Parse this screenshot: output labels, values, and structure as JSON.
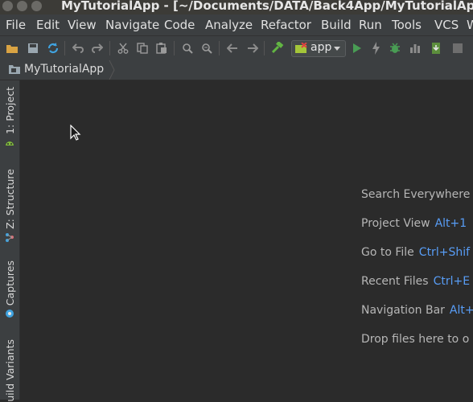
{
  "window": {
    "title": "MyTutorialApp - [~/Documents/DATA/Back4App/MyTutorialApp] - "
  },
  "menu": [
    {
      "label": "File"
    },
    {
      "label": "Edit"
    },
    {
      "label": "View"
    },
    {
      "label": "Navigate"
    },
    {
      "label": "Code"
    },
    {
      "label": "Analyze"
    },
    {
      "label": "Refactor"
    },
    {
      "label": "Build"
    },
    {
      "label": "Run"
    },
    {
      "label": "Tools"
    },
    {
      "label": "VCS"
    },
    {
      "label": "W"
    }
  ],
  "toolbar": {
    "run_config": "app",
    "icons": [
      "open-folder",
      "save-all",
      "sync",
      "undo",
      "redo",
      "cut",
      "copy",
      "paste",
      "find",
      "replace",
      "back",
      "forward",
      "make-project",
      "run",
      "apply-changes",
      "debug",
      "profile",
      "stop",
      "sdk-manager"
    ]
  },
  "breadcrumb": {
    "project": "MyTutorialApp"
  },
  "side_tabs": [
    {
      "label": "1: Project"
    },
    {
      "label": "Z: Structure"
    },
    {
      "label": "Captures"
    },
    {
      "label": "uild Variants"
    }
  ],
  "hints": [
    {
      "label": "Search Everywhere",
      "shortcut": ""
    },
    {
      "label": "Project View",
      "shortcut": "Alt+1"
    },
    {
      "label": "Go to File",
      "shortcut": "Ctrl+Shif"
    },
    {
      "label": "Recent Files",
      "shortcut": "Ctrl+E"
    },
    {
      "label": "Navigation Bar",
      "shortcut": "Alt+"
    },
    {
      "label": "Drop files here to o",
      "shortcut": ""
    }
  ],
  "colors": {
    "editor_bg": "#2b2b2b",
    "panel_bg": "#3c3f41",
    "shortcut": "#589df6",
    "run_green": "#499c54"
  }
}
